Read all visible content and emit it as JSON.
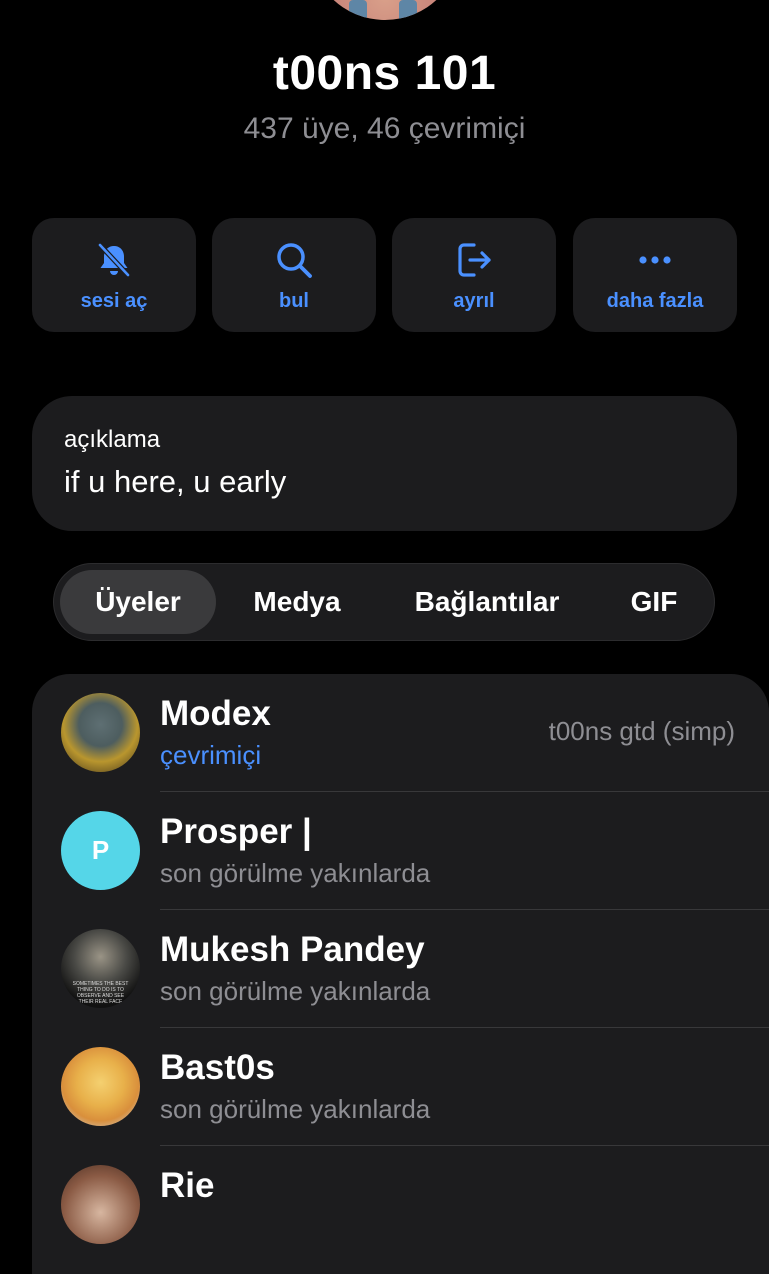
{
  "group": {
    "title": "t00ns 101",
    "subtitle": "437 üye, 46 çevrimiçi"
  },
  "actions": [
    {
      "label": "sesi aç",
      "icon": "bell-slash-icon"
    },
    {
      "label": "bul",
      "icon": "search-icon"
    },
    {
      "label": "ayrıl",
      "icon": "leave-icon"
    },
    {
      "label": "daha fazla",
      "icon": "more-icon"
    }
  ],
  "description": {
    "label": "açıklama",
    "text": "if u here, u early"
  },
  "tabs": [
    {
      "label": "Üyeler",
      "active": true
    },
    {
      "label": "Medya",
      "active": false
    },
    {
      "label": "Bağlantılar",
      "active": false
    },
    {
      "label": "GIF",
      "active": false
    }
  ],
  "members": [
    {
      "name": "Modex",
      "status": "çevrimiçi",
      "role": "t00ns gtd (simp)",
      "online": true
    },
    {
      "name": "Prosper |",
      "status": "son görülme yakınlarda",
      "avatar_letter": "P"
    },
    {
      "name": "Mukesh Pandey",
      "status": "son görülme yakınlarda",
      "avatar_text": "SOMETIMES THE BEST THING TO DO IS TO OBSERVE AND SEE THEIR REAL FACE"
    },
    {
      "name": "Bast0s",
      "status": "son görülme yakınlarda"
    },
    {
      "name": "Rie",
      "status": ""
    }
  ],
  "colors": {
    "accent": "#4a90ff",
    "background": "#000000",
    "card": "#1c1c1e",
    "secondary_text": "#8e8e93",
    "prosper_avatar": "#55d6e8"
  }
}
